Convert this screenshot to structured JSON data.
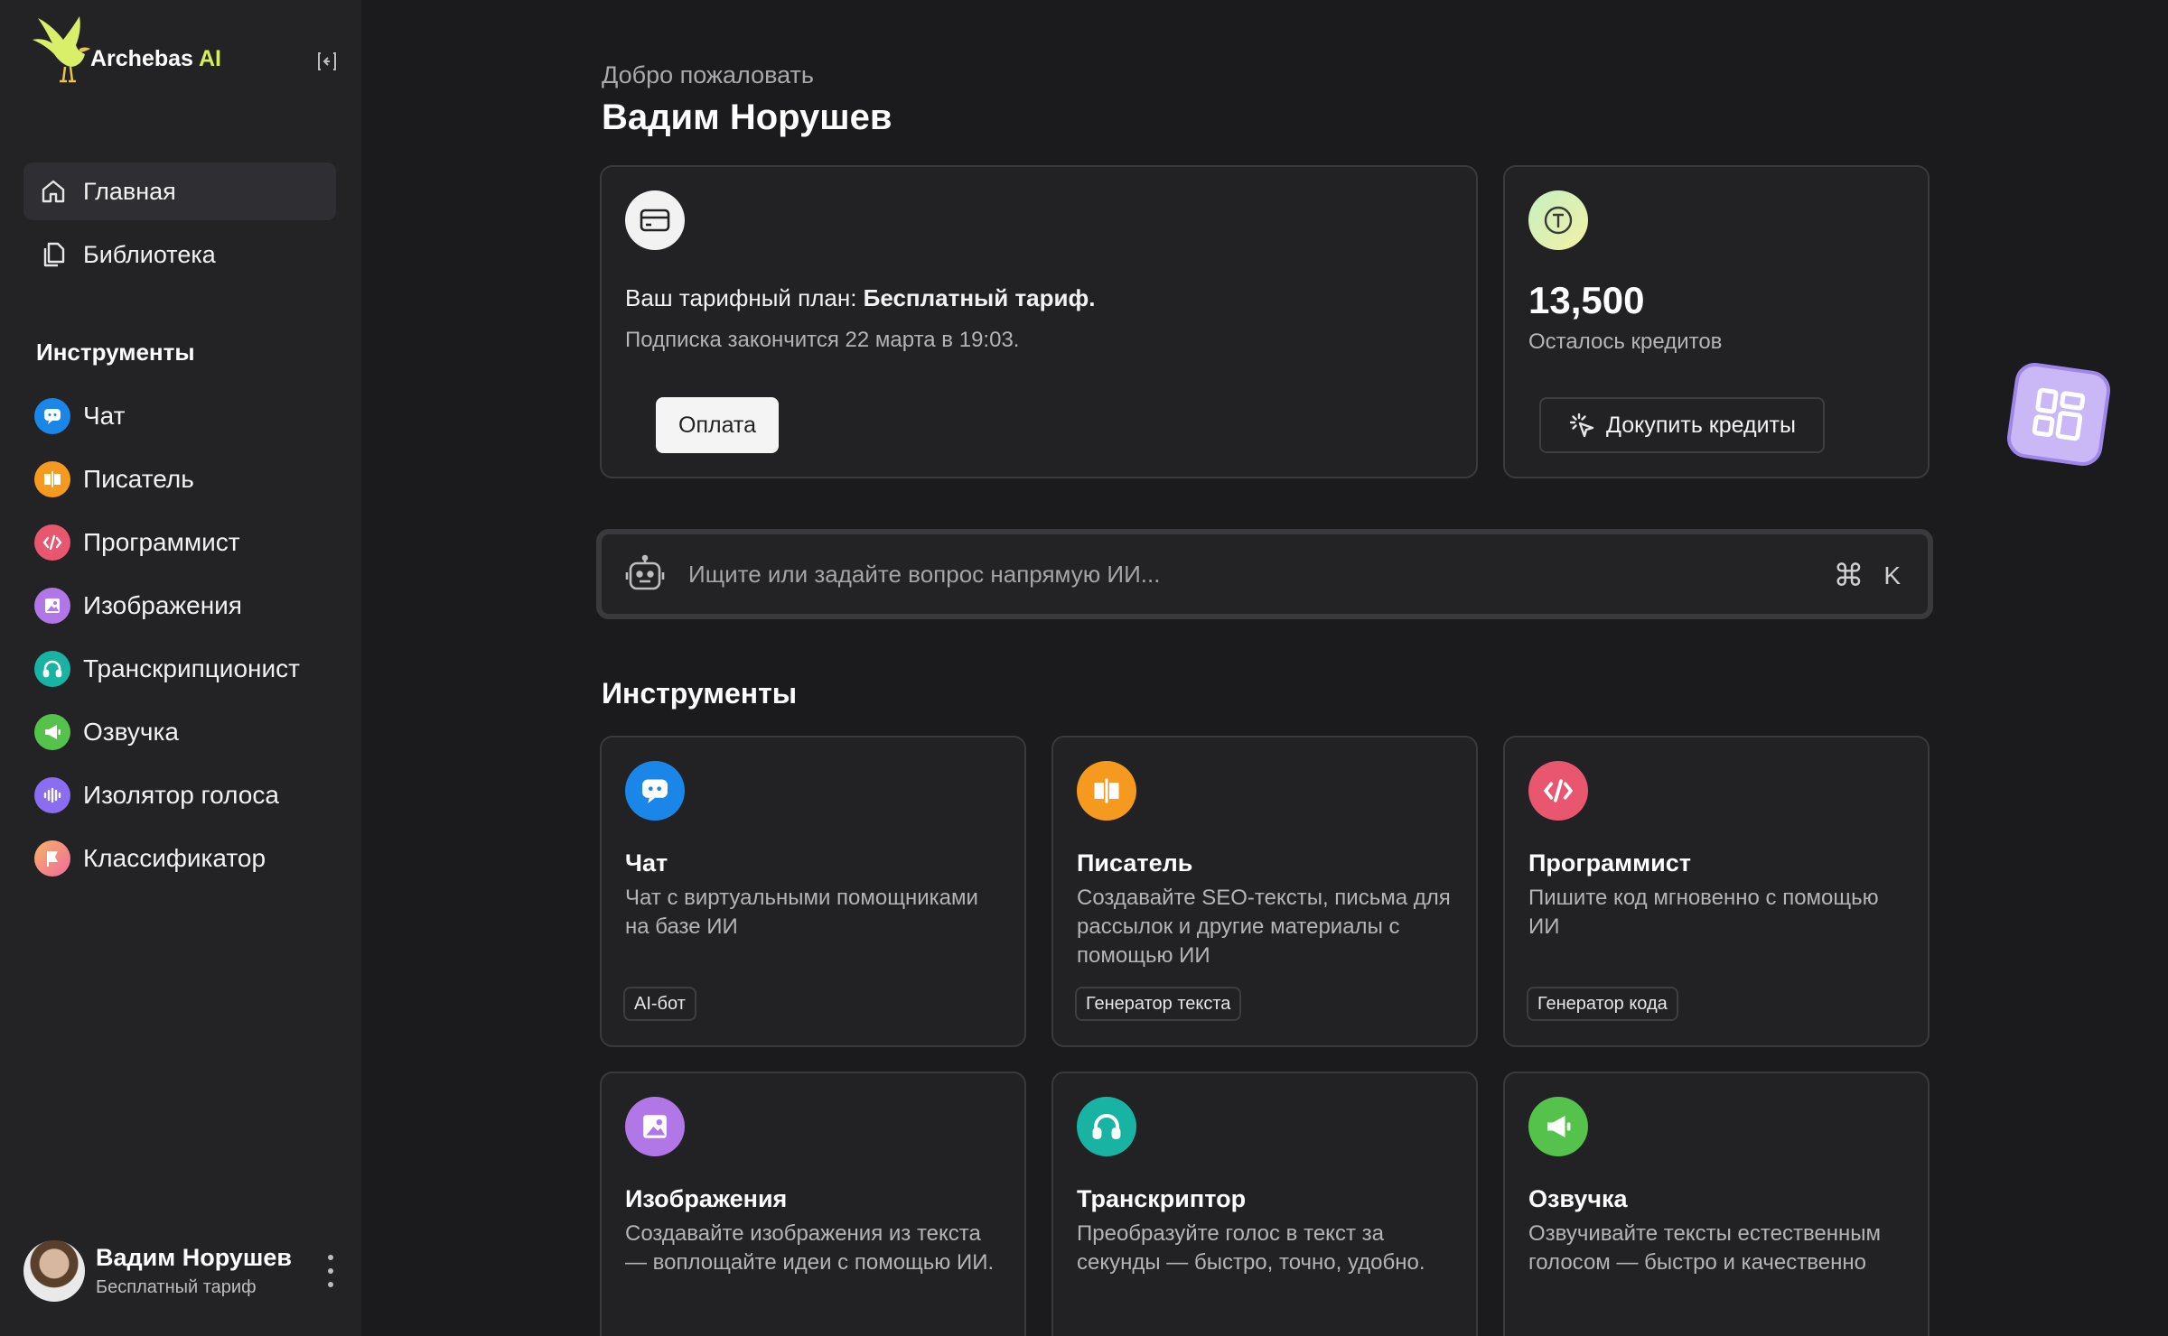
{
  "brand": {
    "name": "Archebas",
    "suffix": "AI"
  },
  "sidebar": {
    "nav": [
      {
        "label": "Главная",
        "icon": "home-icon"
      },
      {
        "label": "Библиотека",
        "icon": "library-icon"
      }
    ],
    "tools_title": "Инструменты",
    "tools": [
      {
        "label": "Чат",
        "icon": "chat-icon",
        "color": "#1a86e8"
      },
      {
        "label": "Писатель",
        "icon": "writer-icon",
        "color": "#f59a1e"
      },
      {
        "label": "Программист",
        "icon": "code-icon",
        "color": "#e8566f"
      },
      {
        "label": "Изображения",
        "icon": "image-icon",
        "color": "#b277e6"
      },
      {
        "label": "Транскрипционист",
        "icon": "headphones-icon",
        "color": "#19b3a3"
      },
      {
        "label": "Озвучка",
        "icon": "megaphone-icon",
        "color": "#55c24c"
      },
      {
        "label": "Изолятор голоса",
        "icon": "waveform-icon",
        "color": "#8a6df0"
      },
      {
        "label": "Классификатор",
        "icon": "flag-icon",
        "color": "#f06a9a"
      }
    ],
    "user": {
      "name": "Вадим Норушев",
      "plan": "Бесплатный тариф"
    }
  },
  "header": {
    "welcome": "Добро пожаловать",
    "title": "Вадим Норушев"
  },
  "plan_card": {
    "plan_prefix": "Ваш тарифный план: ",
    "plan_name": "Бесплатный тариф.",
    "subscription": "Подписка закончится 22 марта в 19:03.",
    "pay_label": "Оплата"
  },
  "credits_card": {
    "value": "13,500",
    "label": "Осталось кредитов",
    "buy_label": "Докупить кредиты"
  },
  "search": {
    "placeholder": "Ищите или задайте вопрос напрямую ИИ...",
    "shortcut_symbol": "⌘",
    "shortcut_key": "K"
  },
  "tools_section": {
    "title": "Инструменты",
    "cards": [
      {
        "title": "Чат",
        "desc": "Чат с виртуальными помощниками на базе ИИ",
        "tag": "AI-бот",
        "icon": "chat-icon",
        "color": "#1a86e8"
      },
      {
        "title": "Писатель",
        "desc": "Создавайте SEO-тексты, письма для рассылок и другие материалы с помощью ИИ",
        "tag": "Генератор текста",
        "icon": "writer-icon",
        "color": "#f59a1e"
      },
      {
        "title": "Программист",
        "desc": "Пишите код мгновенно с помощью ИИ",
        "tag": "Генератор кода",
        "icon": "code-icon",
        "color": "#e8566f"
      },
      {
        "title": "Изображения",
        "desc": "Создавайте изображения из текста — воплощайте идеи с помощью ИИ.",
        "icon": "image-icon",
        "color": "#b277e6"
      },
      {
        "title": "Транскриптор",
        "desc": "Преобразуйте голос в текст за секунды — быстро, точно, удобно.",
        "icon": "headphones-icon",
        "color": "#19b3a3"
      },
      {
        "title": "Озвучка",
        "desc": "Озвучивайте тексты естественным голосом — быстро и качественно",
        "icon": "megaphone-icon",
        "color": "#55c24c"
      }
    ]
  }
}
